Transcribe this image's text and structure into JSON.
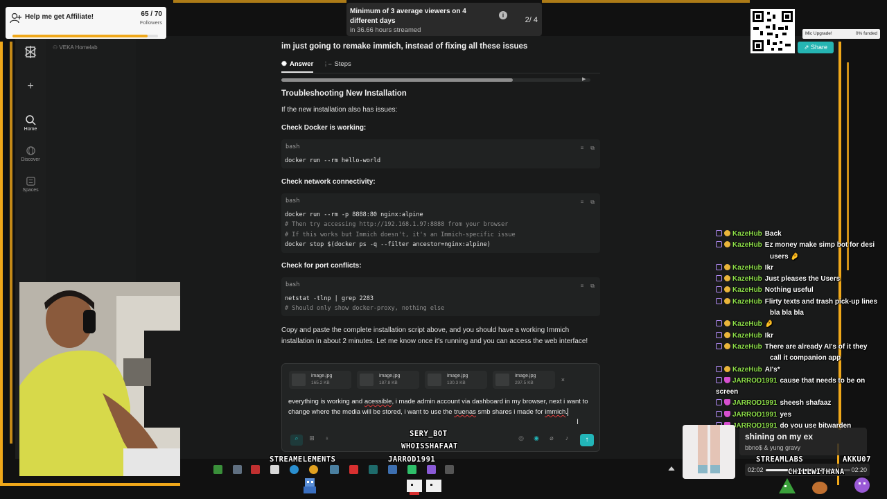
{
  "colors": {
    "frame": "#f0a81a",
    "accent": "#22b5b8",
    "chat_user": "#8ee04a",
    "background": "#191a1a"
  },
  "sidebar": {
    "logo_icon": "perplexity-logo-icon",
    "new_icon": "plus-icon",
    "items": [
      {
        "label": "Home",
        "icon": "search-icon"
      },
      {
        "label": "Discover",
        "icon": "globe-icon"
      },
      {
        "label": "Spaces",
        "icon": "spaces-icon"
      }
    ],
    "space_label": "VEKA Homelab"
  },
  "thread": {
    "question": "im just going to remake immich, instead of fixing all these issues",
    "tabs": [
      {
        "label": "Answer",
        "icon": "answer-icon"
      },
      {
        "label": "Steps",
        "icon": "steps-icon"
      }
    ],
    "section_title": "Troubleshooting New Installation",
    "intro": "If the new installation also has issues:",
    "blocks": [
      {
        "heading": "Check Docker is working:",
        "lang": "bash",
        "lines": [
          "docker run --rm hello-world"
        ]
      },
      {
        "heading": "Check network connectivity:",
        "lang": "bash",
        "lines": [
          "docker run --rm -p 8888:80 nginx:alpine",
          "# Then try accessing http://192.168.1.97:8888 from your browser",
          "# If this works but Immich doesn't, it's an Immich-specific issue",
          "docker stop $(docker ps -q --filter ancestor=nginx:alpine)"
        ]
      },
      {
        "heading": "Check for port conflicts:",
        "lang": "bash",
        "lines": [
          "netstat -tlnp | grep 2283",
          "# Should only show docker-proxy, nothing else"
        ]
      }
    ],
    "closing": "Copy and paste the complete installation script above, and you should have a working Immich installation in about 2 minutes. Let me know once it's running and you can access the web interface!"
  },
  "composer": {
    "attachments": [
      {
        "name": "image.jpg",
        "size": "165.2 KB"
      },
      {
        "name": "image.jpg",
        "size": "187.8 KB"
      },
      {
        "name": "image.jpg",
        "size": "130.3 KB"
      },
      {
        "name": "image.jpg",
        "size": "297.5 KB"
      }
    ],
    "text_parts": [
      "everything is working and ",
      "acessible",
      ", i made admin account via dashboard in my browser, next i want to change where the media will be stored, i want to use the ",
      "truenas",
      " smb shares i made for ",
      "immich",
      ". "
    ],
    "send_icon": "arrow-up-icon"
  },
  "overlays": {
    "follower_goal": {
      "title": "Help me get Affiliate!",
      "count": "65 / 70",
      "sub": "Followers",
      "progress": 0.93
    },
    "viewer_goal": {
      "text": "Minimum of 3 average viewers on 4 different days",
      "sub": "in 36.66 hours streamed",
      "count": "2/ 4"
    },
    "mic_upgrade": {
      "label": "Mic Upgrade!",
      "funded": "0% funded"
    },
    "share_label": "Share",
    "bot_names": [
      "SERY_BOT",
      "WHOISSHAFAAT"
    ],
    "bottom_names": [
      "STREAMELEMENTS",
      "JARROD1991",
      "STREAMLABS",
      "AKKU07",
      "CHILLWITHANA"
    ],
    "now_playing": {
      "title": "shining on my ex",
      "artist": "bbno$ & yung gravy",
      "elapsed": "02:02",
      "total": "02:20",
      "progress": 0.87
    }
  },
  "chat": [
    {
      "user": "KazeHub",
      "lines": [
        "Back"
      ]
    },
    {
      "user": "KazeHub",
      "lines": [
        "Ez money make simp bot for desi",
        "users 🤌"
      ]
    },
    {
      "user": "KazeHub",
      "lines": [
        "Ikr"
      ]
    },
    {
      "user": "KazeHub",
      "lines": [
        "Just pleases the Users"
      ]
    },
    {
      "user": "KazeHub",
      "lines": [
        "Nothing useful"
      ]
    },
    {
      "user": "KazeHub",
      "lines": [
        "Flirty texts and trash pick-up lines",
        "bla bla bla"
      ]
    },
    {
      "user": "KazeHub",
      "lines": [
        "🤌"
      ]
    },
    {
      "user": "KazeHub",
      "lines": [
        "Ikr"
      ]
    },
    {
      "user": "KazeHub",
      "lines": [
        "There are already AI's of it they",
        "call it companion app"
      ]
    },
    {
      "user": "KazeHub",
      "lines": [
        "AI's*"
      ]
    },
    {
      "user": "JARROD1991",
      "lines": [
        "cause that needs to be on screen"
      ]
    },
    {
      "user": "JARROD1991",
      "lines": [
        "sheesh shafaaz"
      ]
    },
    {
      "user": "JARROD1991",
      "lines": [
        "yes"
      ]
    },
    {
      "user": "JARROD1991",
      "lines": [
        "do you use bitwarden"
      ]
    }
  ]
}
